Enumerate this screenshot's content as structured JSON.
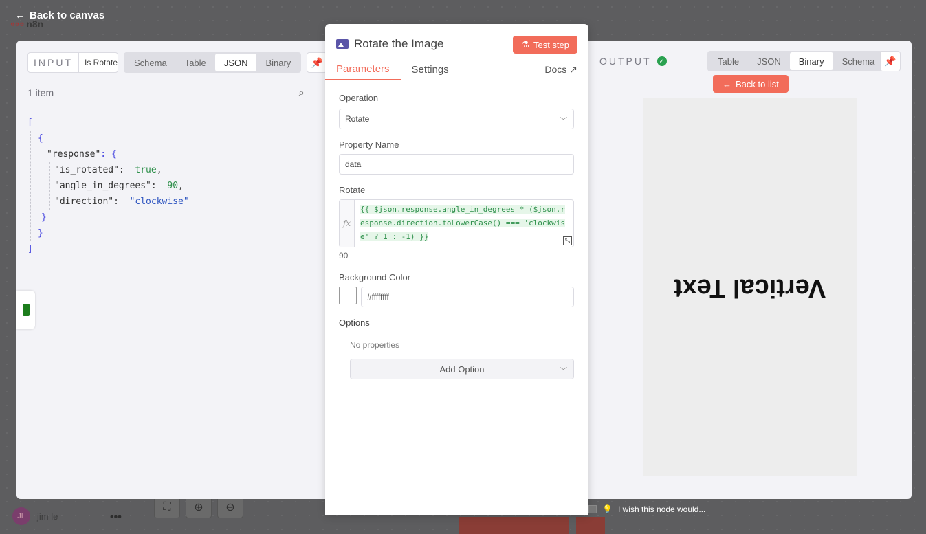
{
  "app": {
    "logo_text": "n8n",
    "back_to_canvas": "Back to canvas"
  },
  "colors": {
    "accent": "#f26c5a",
    "success": "#2aa150",
    "json_string": "#2d54c0",
    "json_value": "#2d8f4a"
  },
  "input": {
    "label": "INPUT",
    "node_select_value": "Is Rotated?",
    "view_tabs": [
      "Schema",
      "Table",
      "JSON",
      "Binary"
    ],
    "active_view": "JSON",
    "items_count": "1 item",
    "json_lines": {
      "open_bracket": "[",
      "open_brace": "{",
      "response_key": "\"response\"",
      "response_open": "{",
      "is_rotated_key": "\"is_rotated\"",
      "is_rotated_val": "true",
      "angle_key": "\"angle_in_degrees\"",
      "angle_val": "90",
      "direction_key": "\"direction\"",
      "direction_val": "\"clockwise\"",
      "close_inner": "}",
      "close_brace": "}",
      "close_bracket": "]"
    }
  },
  "node": {
    "title": "Rotate the Image",
    "test_step": "Test step",
    "tabs": [
      "Parameters",
      "Settings"
    ],
    "docs": "Docs",
    "fields": {
      "operation_label": "Operation",
      "operation_value": "Rotate",
      "property_label": "Property Name",
      "property_value": "data",
      "rotate_label": "Rotate",
      "rotate_expression": "{{ $json.response.angle_in_degrees * ($json.response.direction.toLowerCase() === 'clockwise' ? 1 : -1) }}",
      "rotate_result": "90",
      "bg_label": "Background Color",
      "bg_value": "#ffffffff",
      "options_label": "Options",
      "no_properties": "No properties",
      "add_option": "Add Option"
    }
  },
  "output": {
    "label": "OUTPUT",
    "view_tabs": [
      "Table",
      "JSON",
      "Binary",
      "Schema"
    ],
    "active_view": "Binary",
    "back_to_list": "Back to list",
    "preview_text": "Vertical Text"
  },
  "footer": {
    "user_initials": "JL",
    "user_name": "jim le",
    "wish_text": "I wish this node would..."
  }
}
